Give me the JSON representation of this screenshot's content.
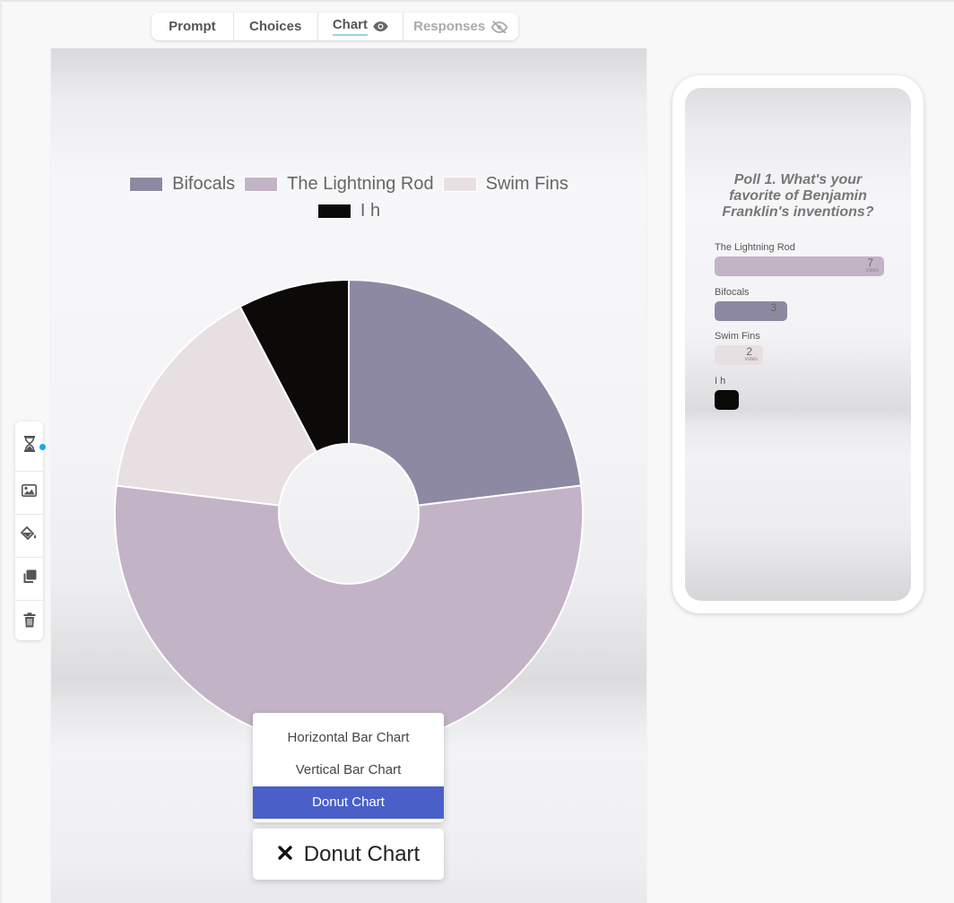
{
  "tabs": [
    {
      "label": "Prompt",
      "icon": "",
      "active": false
    },
    {
      "label": "Choices",
      "icon": "",
      "active": false
    },
    {
      "label": "Chart",
      "icon": "eye-icon",
      "active": true
    },
    {
      "label": "Responses",
      "icon": "eye-slash-icon",
      "active": false
    }
  ],
  "chart_data": {
    "type": "pie",
    "variant": "donut",
    "categories": [
      "Bifocals",
      "The Lightning Rod",
      "Swim Fins",
      "I h"
    ],
    "values": [
      3,
      7,
      2,
      1
    ],
    "colors": [
      "#8e89a3",
      "#c3b3c6",
      "#e8dfe3",
      "#0b0a09"
    ],
    "legend_position": "top"
  },
  "chart_type_menu": {
    "options": [
      "Horizontal Bar Chart",
      "Vertical Bar Chart",
      "Donut Chart"
    ],
    "selected": "Donut Chart"
  },
  "chart_type_select": {
    "label": "Donut Chart",
    "icon": "close-icon"
  },
  "toolbar": {
    "tools": [
      "hourglass-icon",
      "image-icon",
      "paint-bucket-icon",
      "copy-icon",
      "trash-icon"
    ],
    "indicator_color": "#1aa7ee"
  },
  "preview": {
    "title": "Poll 1. What's your favorite of Benjamin Franklin's inventions?",
    "results": [
      {
        "label": "The Lightning Rod",
        "count": "7",
        "unit": "votes",
        "color": "#c3b3c6"
      },
      {
        "label": "Bifocals",
        "count": "3",
        "unit": "votes",
        "color": "#8e89a3"
      },
      {
        "label": "Swim Fins",
        "count": "2",
        "unit": "votes",
        "color": "#e8dfe3"
      },
      {
        "label": "I h",
        "count": "",
        "unit": "",
        "color": "#0b0a09"
      }
    ]
  }
}
